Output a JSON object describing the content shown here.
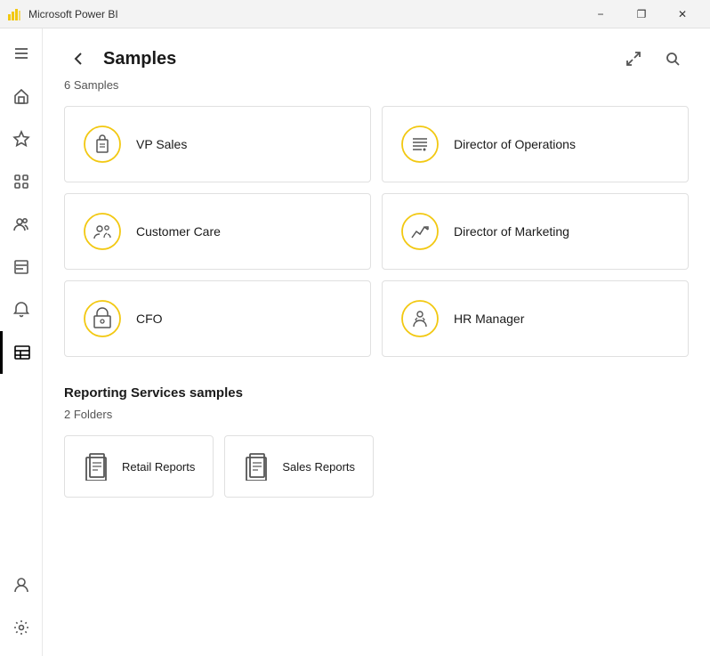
{
  "titleBar": {
    "appName": "Microsoft Power BI",
    "minimizeLabel": "−",
    "restoreLabel": "❐",
    "closeLabel": "✕"
  },
  "header": {
    "title": "Samples",
    "backLabel": "←",
    "expandIcon": "expand",
    "searchIcon": "search"
  },
  "samplesCount": "6 Samples",
  "samples": [
    {
      "id": "vp-sales",
      "name": "VP Sales",
      "iconType": "briefcase"
    },
    {
      "id": "director-operations",
      "name": "Director of Operations",
      "iconType": "list"
    },
    {
      "id": "customer-care",
      "name": "Customer Care",
      "iconType": "people"
    },
    {
      "id": "director-marketing",
      "name": "Director of Marketing",
      "iconType": "chart"
    },
    {
      "id": "cfo",
      "name": "CFO",
      "iconType": "box"
    },
    {
      "id": "hr-manager",
      "name": "HR Manager",
      "iconType": "hr"
    }
  ],
  "reportingServices": {
    "sectionTitle": "Reporting Services samples",
    "foldersCount": "2 Folders",
    "folders": [
      {
        "id": "retail-reports",
        "name": "Retail Reports",
        "iconType": "folder"
      },
      {
        "id": "sales-reports",
        "name": "Sales Reports",
        "iconType": "folder"
      }
    ]
  },
  "sidebar": {
    "items": [
      {
        "id": "hamburger",
        "icon": "menu",
        "label": "Menu"
      },
      {
        "id": "home",
        "icon": "home",
        "label": "Home"
      },
      {
        "id": "favorites",
        "icon": "star",
        "label": "Favorites"
      },
      {
        "id": "apps",
        "icon": "apps",
        "label": "Apps"
      },
      {
        "id": "shared",
        "icon": "people",
        "label": "Shared with me"
      },
      {
        "id": "learn",
        "icon": "book",
        "label": "Learn"
      },
      {
        "id": "notifications",
        "icon": "bell",
        "label": "Notifications"
      },
      {
        "id": "reports",
        "icon": "table",
        "label": "Reports",
        "active": true
      }
    ],
    "bottom": [
      {
        "id": "account",
        "icon": "person",
        "label": "Account"
      },
      {
        "id": "settings",
        "icon": "gear",
        "label": "Settings"
      }
    ]
  }
}
